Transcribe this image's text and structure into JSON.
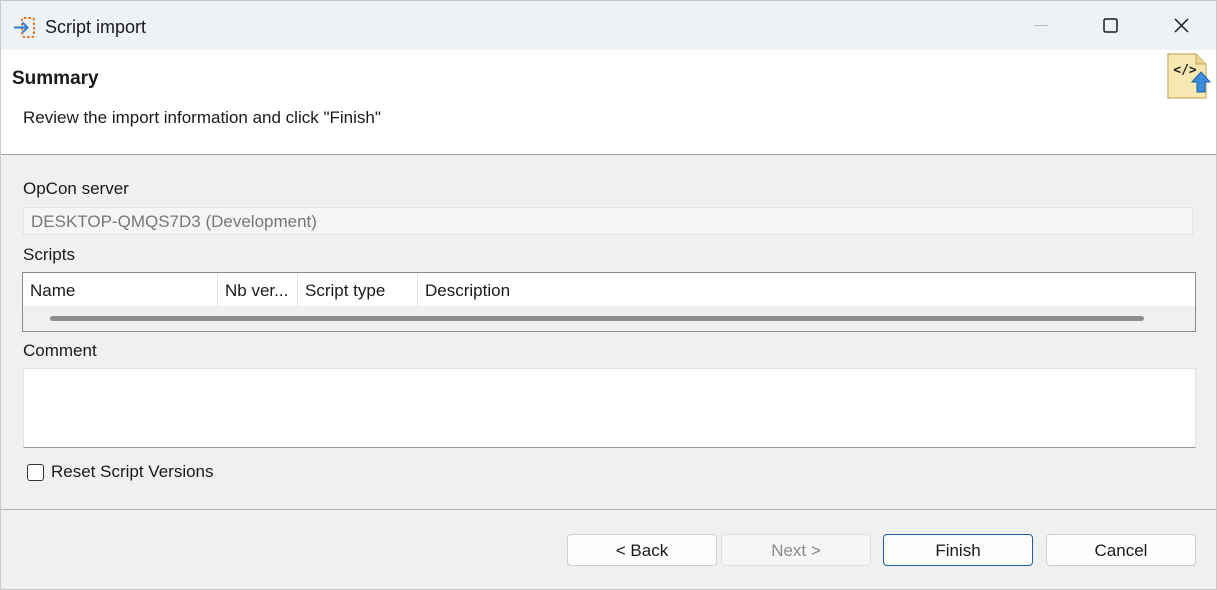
{
  "window": {
    "title": "Script import",
    "app_icon": "import-arrow-icon",
    "controls": [
      "minimize-icon",
      "maximize-icon",
      "close-icon"
    ]
  },
  "banner": {
    "title": "Summary",
    "description": "Review the import information and click \"Finish\"",
    "icon": "script-import-icon"
  },
  "form": {
    "server_label": "OpCon server",
    "server_value": "DESKTOP-QMQS7D3 (Development)",
    "scripts_label": "Scripts",
    "columns": [
      "Name",
      "Nb ver...",
      "Script type",
      "Description"
    ],
    "comment_label": "Comment",
    "comment_value": "",
    "reset_label": "Reset Script Versions",
    "reset_checked": false
  },
  "buttons": {
    "back": "< Back",
    "next": "Next >",
    "finish": "Finish",
    "cancel": "Cancel"
  },
  "colors": {
    "accent": "#1f5fa8",
    "titlebar": "#eef2f7",
    "icon_orange": "#e8762c",
    "icon_blue": "#2f7fd6"
  }
}
